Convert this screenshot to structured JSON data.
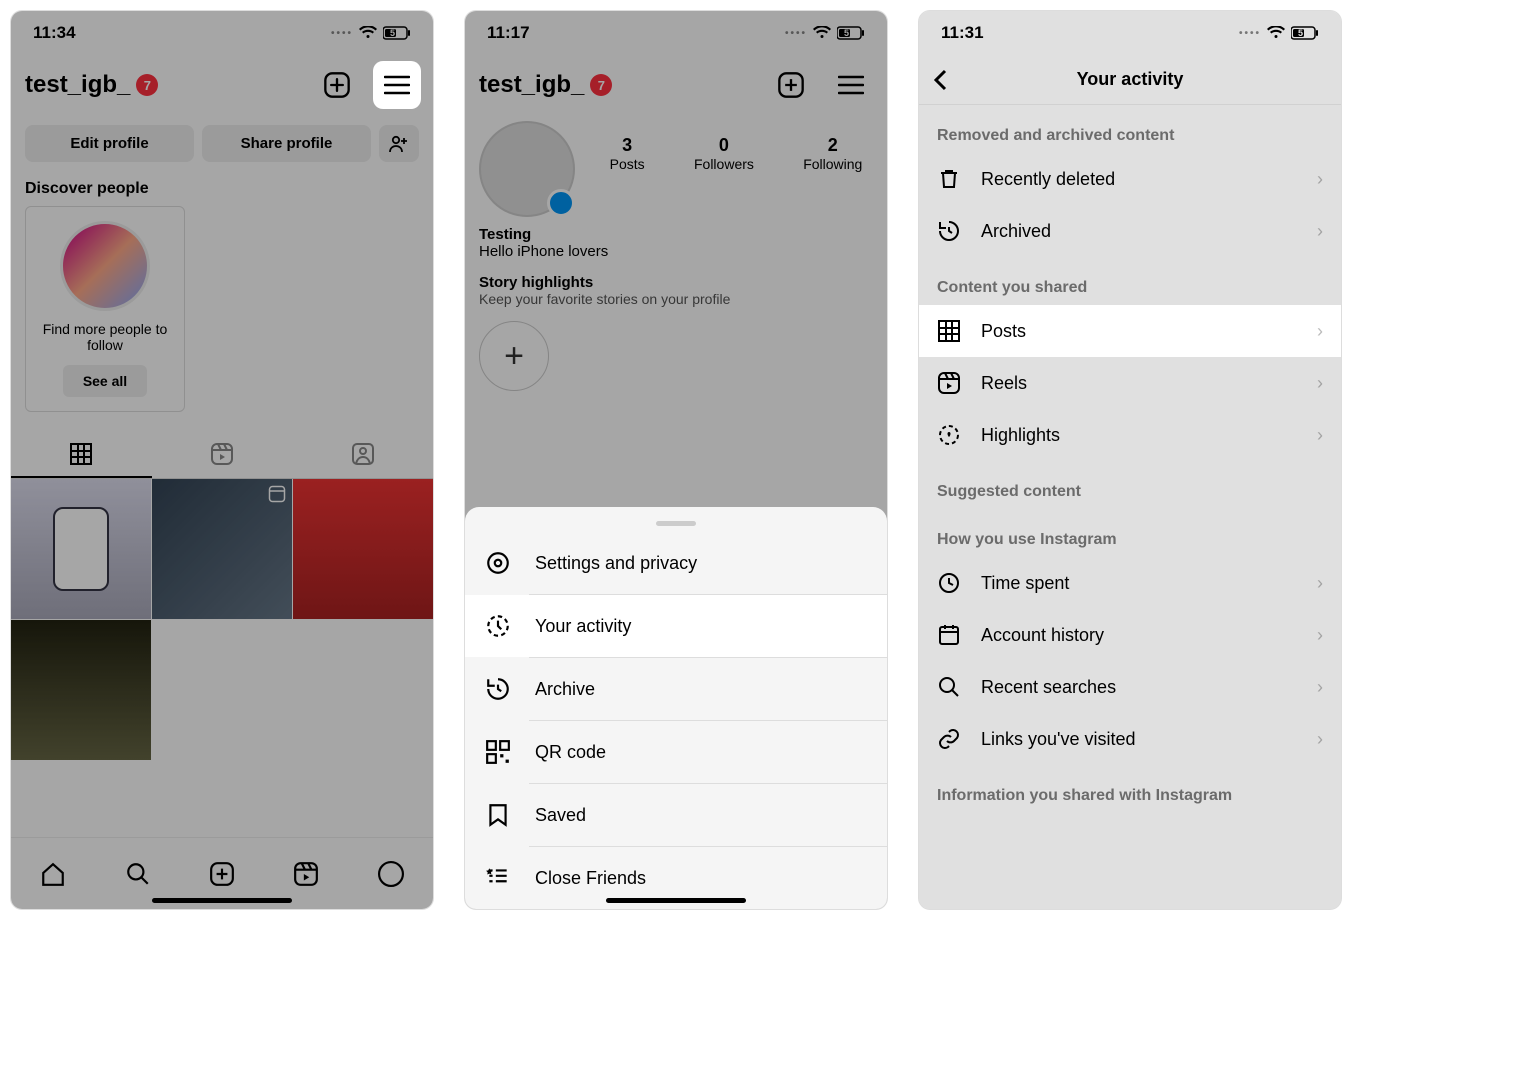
{
  "s1": {
    "time": "11:34",
    "battery": "5",
    "username": "test_igb_",
    "badge": "7",
    "edit_profile": "Edit profile",
    "share_profile": "Share profile",
    "discover_title": "Discover people",
    "discover_card_text": "Find more people to follow",
    "see_all": "See all"
  },
  "s2": {
    "time": "11:17",
    "battery": "5",
    "username": "test_igb_",
    "badge": "7",
    "posts_num": "3",
    "posts_lbl": "Posts",
    "followers_num": "0",
    "followers_lbl": "Followers",
    "following_num": "2",
    "following_lbl": "Following",
    "bio_name": "Testing",
    "bio_text": "Hello iPhone lovers",
    "story_title": "Story highlights",
    "story_sub": "Keep your favorite stories on your profile",
    "menu": {
      "settings": "Settings and privacy",
      "activity": "Your activity",
      "archive": "Archive",
      "qr": "QR code",
      "saved": "Saved",
      "close_friends": "Close Friends"
    }
  },
  "s3": {
    "time": "11:31",
    "battery": "5",
    "title": "Your activity",
    "sec1": "Removed and archived content",
    "recently_deleted": "Recently deleted",
    "archived": "Archived",
    "sec2": "Content you shared",
    "posts": "Posts",
    "reels": "Reels",
    "highlights": "Highlights",
    "sec3": "Suggested content",
    "sec4": "How you use Instagram",
    "time_spent": "Time spent",
    "account_history": "Account history",
    "recent_searches": "Recent searches",
    "links_visited": "Links you've visited",
    "sec5": "Information you shared with Instagram"
  }
}
